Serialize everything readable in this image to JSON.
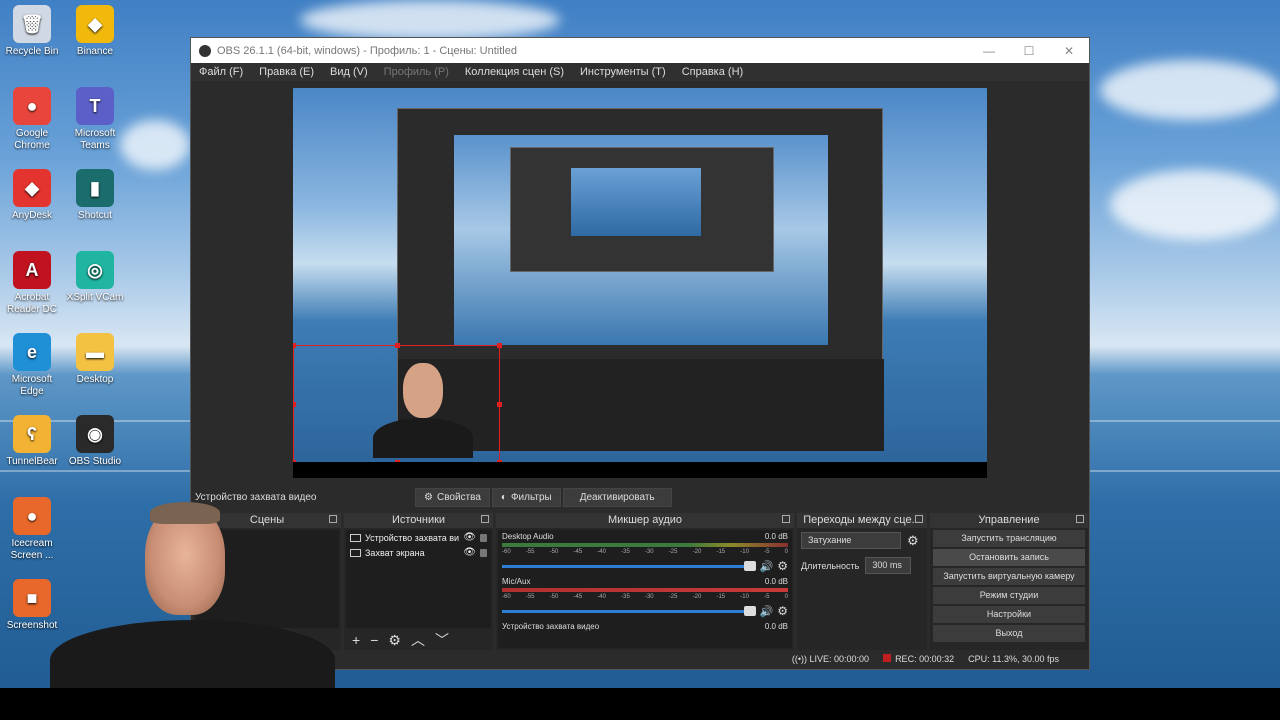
{
  "desktop": {
    "icons_left": [
      {
        "label": "Recycle Bin",
        "glyph": "🗑",
        "color": "#cfd8e3"
      },
      {
        "label": "Google Chrome",
        "glyph": "●",
        "color": "#e8453c"
      },
      {
        "label": "AnyDesk",
        "glyph": "◆",
        "color": "#e3342f"
      },
      {
        "label": "Acrobat Reader DC",
        "glyph": "A",
        "color": "#c1121f"
      },
      {
        "label": "Microsoft Edge",
        "glyph": "e",
        "color": "#1f8fd6"
      },
      {
        "label": "TunnelBear",
        "glyph": "ʕ",
        "color": "#f2b233"
      },
      {
        "label": "Icecream Screen ...",
        "glyph": "●",
        "color": "#e8672a"
      },
      {
        "label": "Screenshot",
        "glyph": "■",
        "color": "#e8672a"
      }
    ],
    "icons_right": [
      {
        "label": "Binance",
        "glyph": "◆",
        "color": "#f0b90b"
      },
      {
        "label": "Microsoft Teams",
        "glyph": "T",
        "color": "#5b5fc7"
      },
      {
        "label": "Shotcut",
        "glyph": "▮",
        "color": "#1b6c6c"
      },
      {
        "label": "XSplit VCam",
        "glyph": "◎",
        "color": "#1fb5a0"
      },
      {
        "label": "Desktop",
        "glyph": "▬",
        "color": "#f4c242"
      },
      {
        "label": "OBS Studio",
        "glyph": "◉",
        "color": "#2a2a2a"
      }
    ]
  },
  "window": {
    "title": "OBS 26.1.1 (64-bit, windows) - Профиль: 1 - Сцены: Untitled",
    "controls": [
      "—",
      "☐",
      "✕"
    ]
  },
  "menu": [
    {
      "label": "Файл (F)",
      "disabled": false
    },
    {
      "label": "Правка (E)",
      "disabled": false
    },
    {
      "label": "Вид (V)",
      "disabled": false
    },
    {
      "label": "Профиль (P)",
      "disabled": true
    },
    {
      "label": "Коллекция сцен (S)",
      "disabled": false
    },
    {
      "label": "Инструменты (T)",
      "disabled": false
    },
    {
      "label": "Справка (H)",
      "disabled": false
    }
  ],
  "context": {
    "source": "Устройство захвата видео",
    "properties": "Свойства",
    "filters": "Фильтры",
    "deactivate": "Деактивировать"
  },
  "docks": {
    "scenes": "Сцены",
    "sources": "Источники",
    "mixer": "Микшер аудио",
    "transitions": "Переходы между сце...",
    "controls": "Управление"
  },
  "sources": [
    {
      "label": "Устройство захвата ви",
      "icon": "camera-icon"
    },
    {
      "label": "Захват экрана",
      "icon": "monitor-icon"
    }
  ],
  "mixer": [
    {
      "name": "Desktop Audio",
      "db": "0.0 dB",
      "muted": false
    },
    {
      "name": "Mic/Aux",
      "db": "0.0 dB",
      "muted": false
    },
    {
      "name": "Устройство захвата видео",
      "db": "0.0 dB",
      "muted": false
    }
  ],
  "mixer_ticks": [
    "-60",
    "-55",
    "-50",
    "-45",
    "-40",
    "-35",
    "-30",
    "-25",
    "-20",
    "-15",
    "-10",
    "-5",
    "0"
  ],
  "transitions": {
    "type": "Затухание",
    "duration_label": "Длительность",
    "duration": "300 ms"
  },
  "controls": [
    {
      "label": "Запустить трансляцию",
      "active": false
    },
    {
      "label": "Остановить запись",
      "active": true
    },
    {
      "label": "Запустить виртуальную камеру",
      "active": false
    },
    {
      "label": "Режим студии",
      "active": false
    },
    {
      "label": "Настройки",
      "active": false
    },
    {
      "label": "Выход",
      "active": false
    }
  ],
  "status": {
    "live": "LIVE: 00:00:00",
    "rec": "REC: 00:00:32",
    "cpu": "CPU: 11.3%, 30.00 fps"
  }
}
